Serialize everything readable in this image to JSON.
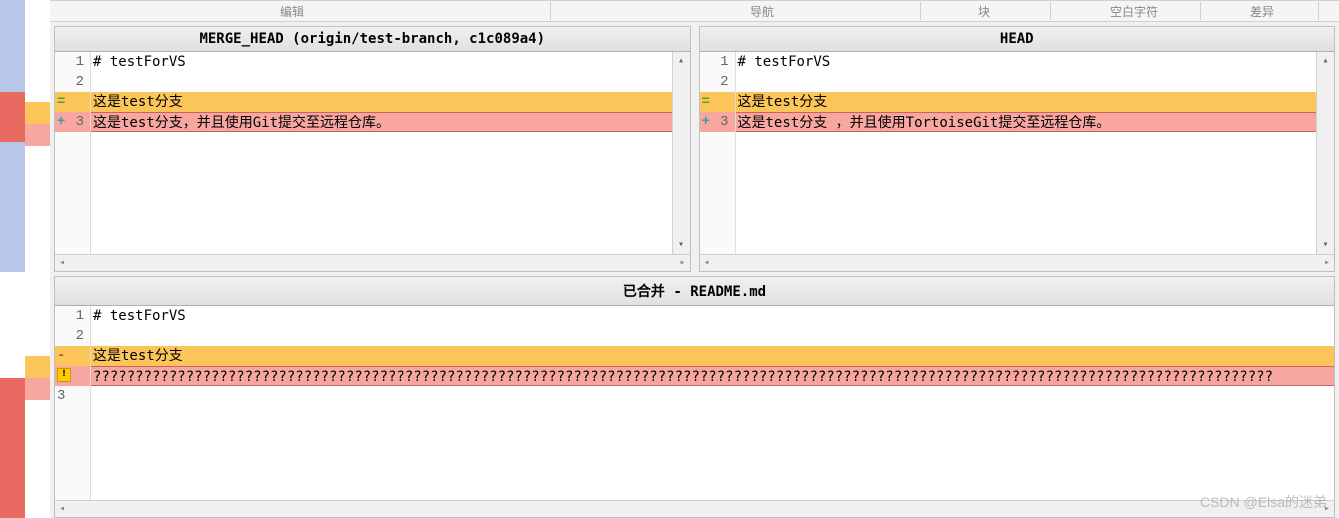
{
  "toolbar": {
    "items": [
      "编辑",
      "导航",
      "块",
      "空白字符",
      "差异"
    ]
  },
  "colors": {
    "yellow": "#fbc55a",
    "red": "#f7a6a0",
    "blue": "#b8c6ea",
    "darkred": "#e96a60"
  },
  "pane_left": {
    "title": "MERGE_HEAD (origin/test-branch, c1c089a4)",
    "lines": [
      {
        "num": "1",
        "mark": "",
        "text": "# testForVS",
        "cls": ""
      },
      {
        "num": "2",
        "mark": "",
        "text": "",
        "cls": ""
      },
      {
        "num": "",
        "mark": "=",
        "mark_color": "#5aa02c",
        "text": "这是test分支",
        "cls": "hl-yellow"
      },
      {
        "num": "3",
        "mark": "+",
        "mark_color": "#3aa0a0",
        "text": "这是test分支，并且使用Git提交至远程仓库。",
        "cls": "hl-red"
      }
    ]
  },
  "pane_right": {
    "title": "HEAD",
    "lines": [
      {
        "num": "1",
        "mark": "",
        "text": "# testForVS",
        "cls": ""
      },
      {
        "num": "2",
        "mark": "",
        "text": "",
        "cls": ""
      },
      {
        "num": "",
        "mark": "=",
        "mark_color": "#5aa02c",
        "text": "这是test分支",
        "cls": "hl-yellow"
      },
      {
        "num": "3",
        "mark": "+",
        "mark_color": "#3aa0a0",
        "text": "这是test分支 ，并且使用TortoiseGit提交至远程仓库。",
        "cls": "hl-red"
      }
    ]
  },
  "pane_bottom": {
    "title": "已合并 - README.md",
    "lines": [
      {
        "num": "1",
        "mark": "",
        "text": "# testForVS",
        "cls": ""
      },
      {
        "num": "2",
        "mark": "",
        "text": "",
        "cls": ""
      },
      {
        "num": "",
        "mark": "-",
        "mark_color": "#b05050",
        "text": "这是test分支",
        "cls": "hl-yellow"
      },
      {
        "num": "3",
        "mark": "!",
        "warn": true,
        "text": "????????????????????????????????????????????????????????????????????????????????????????????????????????????????????????????????????????????",
        "cls": "hl-red"
      }
    ]
  },
  "watermark": "CSDN @Elsa的迷弟"
}
